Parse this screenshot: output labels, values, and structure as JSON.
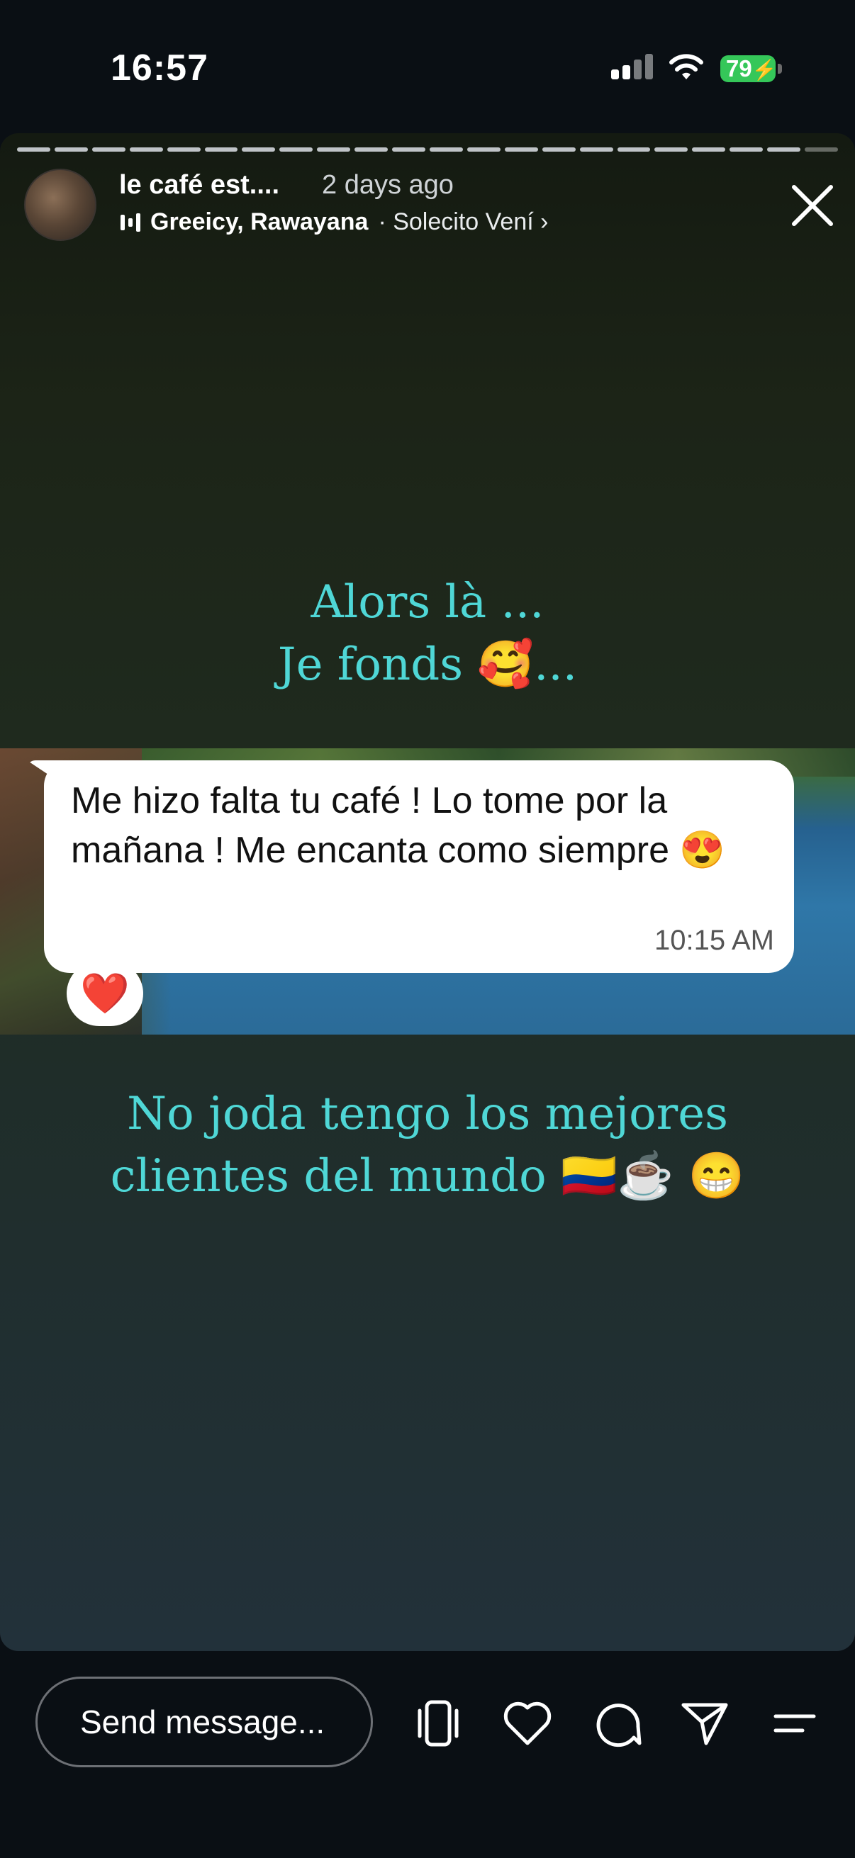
{
  "status_bar": {
    "time": "16:57",
    "battery": "79"
  },
  "story": {
    "account_name": "le café est....",
    "time_ago": "2 days ago",
    "music": {
      "artists": "Greeicy, Rawayana",
      "song": "· Solecito Vení ›"
    },
    "headline_top_line1": "Alors là ...",
    "headline_top_line2": "Je fonds 🥰...",
    "chat_message": "Me hizo falta tu café ! Lo tome por la mañana ! Me encanta como siempre 😍",
    "chat_time": "10:15 AM",
    "reaction": "❤️",
    "headline_bottom_line1": "No joda tengo los mejores",
    "headline_bottom_line2": "clientes del mundo 🇨🇴☕ 😁"
  },
  "bottom_bar": {
    "message_placeholder": "Send message..."
  },
  "icons": [
    "close-icon",
    "music-bars-icon",
    "rotate-device-icon",
    "heart-icon",
    "comment-icon",
    "send-icon",
    "menu-icon"
  ]
}
